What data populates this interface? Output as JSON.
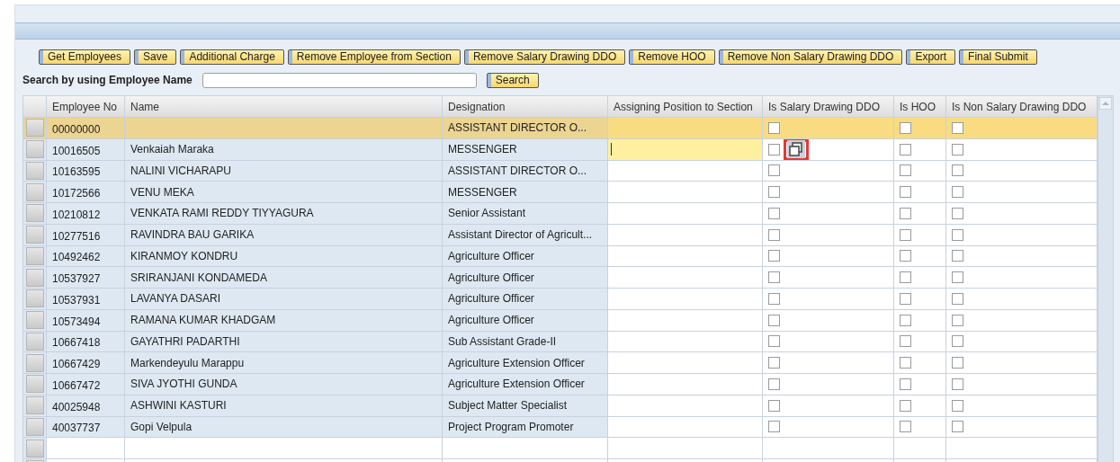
{
  "toolbar": {
    "buttons": [
      "Get Employees",
      "Save",
      "Additional Charge",
      "Remove Employee from Section",
      "Remove Salary Drawing DDO",
      "Remove HOO",
      "Remove Non Salary Drawing DDO",
      "Export",
      "Final Submit"
    ]
  },
  "search": {
    "label": "Search by using Employee Name",
    "button": "Search"
  },
  "table": {
    "columns": [
      "Employee No",
      "Name",
      "Designation",
      "Assigning Position to Section",
      "Is Salary Drawing DDO",
      "Is HOO",
      "Is Non Salary Drawing DDO"
    ],
    "rows": [
      {
        "employee_no": "00000000",
        "name": "",
        "designation": "ASSISTANT DIRECTOR O...",
        "selected": true,
        "editing": false,
        "salary_ddo": false,
        "hoo": false,
        "non_salary_ddo": false
      },
      {
        "employee_no": "10016505",
        "name": "Venkaiah Maraka",
        "designation": "MESSENGER",
        "selected": false,
        "editing": true,
        "salary_ddo": false,
        "hoo": false,
        "non_salary_ddo": false
      },
      {
        "employee_no": "10163595",
        "name": "NALINI VICHARAPU",
        "designation": "ASSISTANT DIRECTOR O...",
        "selected": false,
        "editing": false,
        "salary_ddo": false,
        "hoo": false,
        "non_salary_ddo": false
      },
      {
        "employee_no": "10172566",
        "name": "VENU MEKA",
        "designation": "MESSENGER",
        "selected": false,
        "editing": false,
        "salary_ddo": false,
        "hoo": false,
        "non_salary_ddo": false
      },
      {
        "employee_no": "10210812",
        "name": "VENKATA RAMI REDDY TIYYAGURA",
        "designation": "Senior Assistant",
        "selected": false,
        "editing": false,
        "salary_ddo": false,
        "hoo": false,
        "non_salary_ddo": false
      },
      {
        "employee_no": "10277516",
        "name": "RAVINDRA BAU GARIKA",
        "designation": "Assistant Director of Agricult...",
        "selected": false,
        "editing": false,
        "salary_ddo": false,
        "hoo": false,
        "non_salary_ddo": false
      },
      {
        "employee_no": "10492462",
        "name": "KIRANMOY KONDRU",
        "designation": "Agriculture Officer",
        "selected": false,
        "editing": false,
        "salary_ddo": false,
        "hoo": false,
        "non_salary_ddo": false
      },
      {
        "employee_no": "10537927",
        "name": "SRIRANJANI KONDAMEDA",
        "designation": "Agriculture Officer",
        "selected": false,
        "editing": false,
        "salary_ddo": false,
        "hoo": false,
        "non_salary_ddo": false
      },
      {
        "employee_no": "10537931",
        "name": "LAVANYA DASARI",
        "designation": "Agriculture Officer",
        "selected": false,
        "editing": false,
        "salary_ddo": false,
        "hoo": false,
        "non_salary_ddo": false
      },
      {
        "employee_no": "10573494",
        "name": "RAMANA KUMAR KHADGAM",
        "designation": "Agriculture Officer",
        "selected": false,
        "editing": false,
        "salary_ddo": false,
        "hoo": false,
        "non_salary_ddo": false
      },
      {
        "employee_no": "10667418",
        "name": "GAYATHRI PADARTHI",
        "designation": "Sub Assistant Grade-II",
        "selected": false,
        "editing": false,
        "salary_ddo": false,
        "hoo": false,
        "non_salary_ddo": false
      },
      {
        "employee_no": "10667429",
        "name": "Markendeyulu Marappu",
        "designation": "Agriculture Extension Officer",
        "selected": false,
        "editing": false,
        "salary_ddo": false,
        "hoo": false,
        "non_salary_ddo": false
      },
      {
        "employee_no": "10667472",
        "name": "SIVA JYOTHI GUNDA",
        "designation": "Agriculture Extension Officer",
        "selected": false,
        "editing": false,
        "salary_ddo": false,
        "hoo": false,
        "non_salary_ddo": false
      },
      {
        "employee_no": "40025948",
        "name": "ASHWINI KASTURI",
        "designation": "Subject Matter Specialist",
        "selected": false,
        "editing": false,
        "salary_ddo": false,
        "hoo": false,
        "non_salary_ddo": false
      },
      {
        "employee_no": "40037737",
        "name": "Gopi Velpula",
        "designation": "Project Program Promoter",
        "selected": false,
        "editing": false,
        "salary_ddo": false,
        "hoo": false,
        "non_salary_ddo": false
      }
    ]
  }
}
